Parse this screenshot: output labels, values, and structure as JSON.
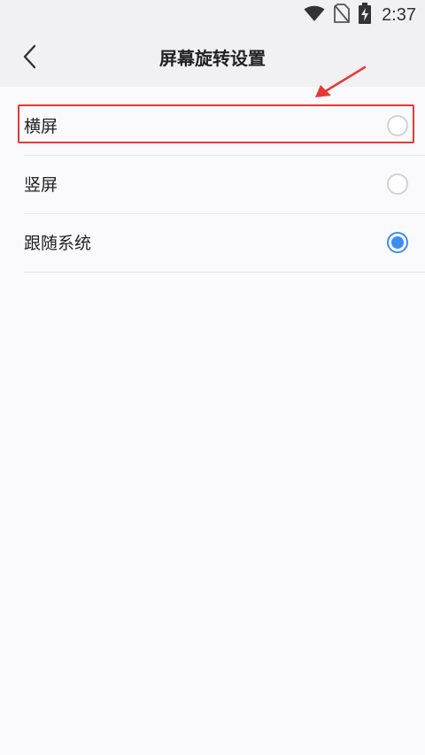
{
  "status_bar": {
    "time": "2:37",
    "icons": [
      "wifi-icon",
      "no-sim-icon",
      "battery-charging-icon"
    ]
  },
  "header": {
    "title": "屏幕旋转设置",
    "back_icon": "back-chevron-icon"
  },
  "options": [
    {
      "label": "横屏",
      "selected": false
    },
    {
      "label": "竖屏",
      "selected": false
    },
    {
      "label": "跟随系统",
      "selected": true
    }
  ],
  "colors": {
    "accent": "#3b8ef3",
    "highlight": "#e53935"
  }
}
